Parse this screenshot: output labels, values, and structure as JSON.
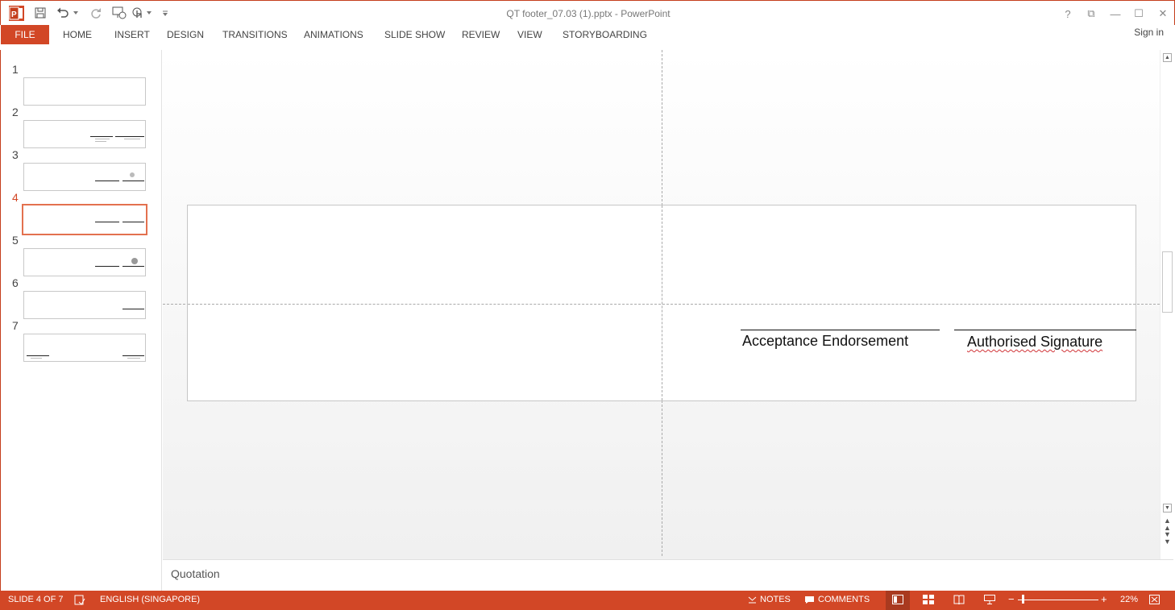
{
  "window": {
    "title": "QT footer_07.03 (1).pptx - PowerPoint",
    "help": "?",
    "restore_ribbon": "⧉",
    "minimize": "—",
    "maximize": "☐",
    "close": "✕"
  },
  "qat": {
    "icons": [
      "powerpoint-app-icon",
      "save-icon",
      "undo-icon",
      "redo-icon",
      "present-from-start-icon",
      "touch-mode-icon",
      "customize-qat-icon"
    ]
  },
  "ribbon": {
    "file": "FILE",
    "tabs": [
      "HOME",
      "INSERT",
      "DESIGN",
      "TRANSITIONS",
      "ANIMATIONS",
      "SLIDE SHOW",
      "REVIEW",
      "VIEW",
      "STORYBOARDING"
    ],
    "sign_in": "Sign in"
  },
  "thumbnails": {
    "numbers": [
      "1",
      "2",
      "3",
      "4",
      "5",
      "6",
      "7"
    ],
    "active_index": 4
  },
  "slide": {
    "acceptance_label": "Acceptance Endorsement",
    "signature_label": "Authorised Signature"
  },
  "notes": {
    "text": "Quotation"
  },
  "status": {
    "slide_info": "SLIDE 4 OF 7",
    "language": "ENGLISH (SINGAPORE)",
    "notes": "NOTES",
    "comments": "COMMENTS",
    "zoom_minus": "−",
    "zoom_plus": "+",
    "zoom": "22%"
  },
  "colors": {
    "accent": "#d24726",
    "active_thumb_border": "#e3714f"
  }
}
